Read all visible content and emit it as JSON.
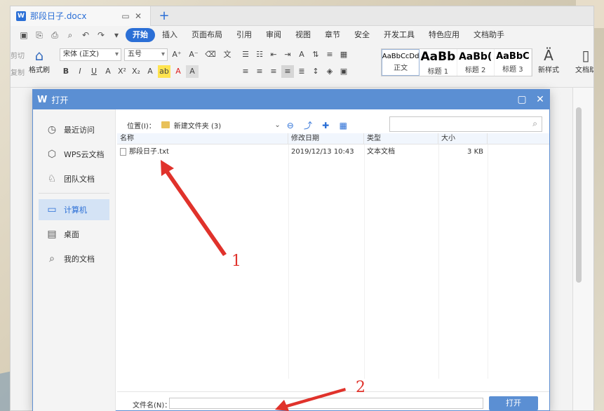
{
  "window": {
    "doc_tab_title": "那段日子.docx",
    "app_badge": "W",
    "new_tab": "+"
  },
  "menubar": {
    "items": [
      "开始",
      "插入",
      "页面布局",
      "引用",
      "审阅",
      "视图",
      "章节",
      "安全",
      "开发工具",
      "特色应用",
      "文档助手"
    ],
    "active_index": 0
  },
  "ribbon": {
    "cut": "剪切",
    "copy": "复制",
    "format_painter": "格式刷",
    "font_name": "宋体 (正文)",
    "font_size": "五号",
    "styles": [
      {
        "preview": "AaBbCcDd",
        "label": "正文"
      },
      {
        "preview": "AaBb",
        "label": "标题 1"
      },
      {
        "preview": "AaBb(",
        "label": "标题 2"
      },
      {
        "preview": "AaBbC",
        "label": "标题 3"
      }
    ],
    "new_style": "新样式",
    "doc_tools": "文档助"
  },
  "dialog": {
    "title": "打开",
    "nav": [
      {
        "label": "最近访问",
        "icon": "clock-icon"
      },
      {
        "label": "WPS云文档",
        "icon": "cube-icon"
      },
      {
        "label": "团队文档",
        "icon": "team-icon"
      },
      {
        "label": "计算机",
        "icon": "computer-icon"
      },
      {
        "label": "桌面",
        "icon": "desktop-icon"
      },
      {
        "label": "我的文档",
        "icon": "mydocs-icon"
      }
    ],
    "active_nav": 3,
    "location_label": "位置(I)：",
    "location_value": "新建文件夹 (3)",
    "search_placeholder": "",
    "columns": [
      "名称",
      "修改日期",
      "类型",
      "大小"
    ],
    "files": [
      {
        "name": "那段日子.txt",
        "modified": "2019/12/13 10:43",
        "type": "文本文档",
        "size": "3 KB"
      }
    ],
    "filename_label": "文件名(N)：",
    "filename_value": "",
    "open_button": "打开"
  },
  "annotations": {
    "label_1": "1",
    "label_2": "2"
  },
  "colors": {
    "accent": "#2b6fd6",
    "dialog_title": "#5b8fd3",
    "annotation": "#e0322b"
  }
}
